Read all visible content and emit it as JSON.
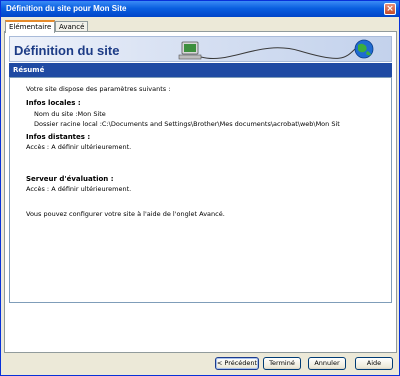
{
  "window": {
    "title": "Définition du site pour Mon Site",
    "close_glyph": "×"
  },
  "tabs": [
    {
      "label": "Elémentaire",
      "active": true
    },
    {
      "label": "Avancé",
      "active": false
    }
  ],
  "banner": {
    "title": "Définition du site",
    "icons": [
      "computer-icon",
      "globe-icon"
    ]
  },
  "section": {
    "title": "Résumé"
  },
  "summary": {
    "intro": "Votre site dispose des paramètres suivants :",
    "local": {
      "heading": "Infos locales :",
      "site_name": "Nom du site :Mon Site",
      "root_folder": "Dossier racine local :C:\\Documents and Settings\\Brother\\Mes documents\\acrobat\\web\\Mon Sit"
    },
    "remote": {
      "heading": "Infos distantes :",
      "access": "Accès : A définir ultérieurement."
    },
    "test_server": {
      "heading": "Serveur d'évaluation :",
      "access": "Accès : A définir ultérieurement."
    },
    "footer_note": "Vous pouvez configurer votre site à l'aide de l'onglet Avancé."
  },
  "buttons": {
    "previous": "< Précédent",
    "finish": "Terminé",
    "cancel": "Annuler",
    "help": "Aide"
  },
  "colors": {
    "title_bar": "#0a5fe0",
    "section_bar": "#1f4aa3",
    "banner_title": "#1d3c86",
    "tab_accent": "#e68b2c"
  }
}
